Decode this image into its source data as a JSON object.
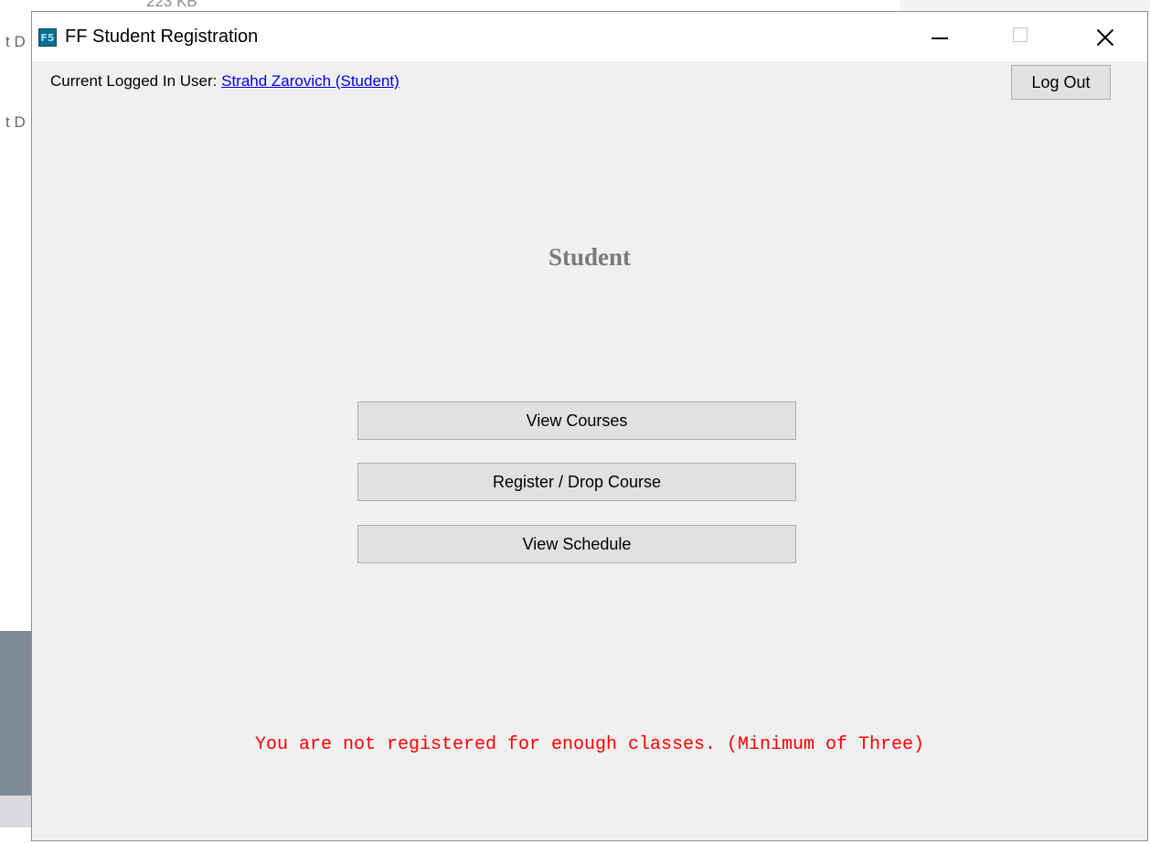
{
  "background": {
    "partial_text": "223 KB",
    "fragment_1": "t D",
    "fragment_2": "t D"
  },
  "window": {
    "icon_label": "F5",
    "title": "FF Student Registration"
  },
  "header": {
    "user_prefix": "Current Logged In User: ",
    "user_name": "Strahd Zarovich (Student)",
    "logout_label": "Log Out"
  },
  "main": {
    "title": "Student",
    "buttons": [
      {
        "label": "View Courses"
      },
      {
        "label": "Register / Drop Course"
      },
      {
        "label": "View Schedule"
      }
    ],
    "warning": "You are not registered for enough classes. (Minimum of Three)"
  },
  "colors": {
    "warning": "#ff0000",
    "link": "#0000ee",
    "title": "#7a7a7a"
  }
}
